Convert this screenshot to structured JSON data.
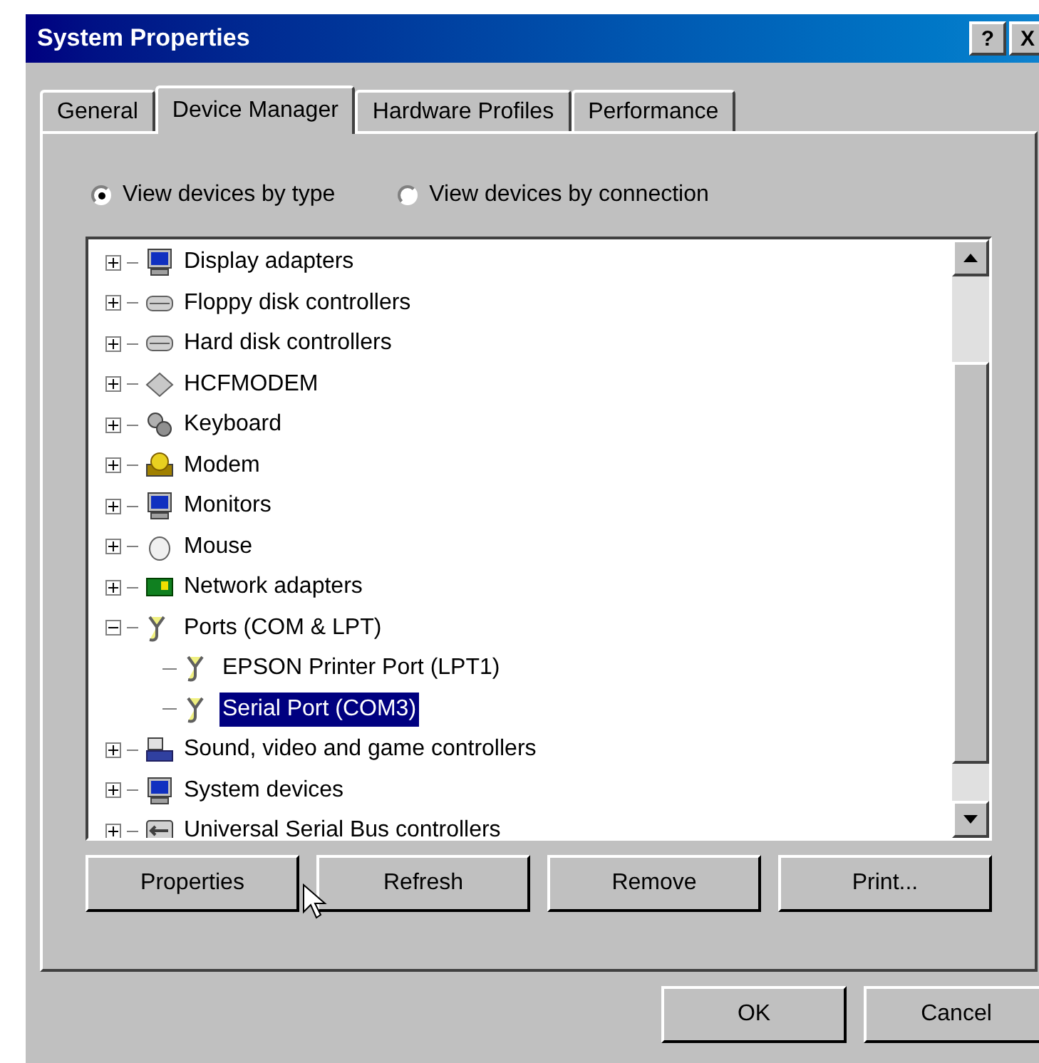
{
  "window": {
    "title": "System Properties",
    "controls": [
      "?",
      "X"
    ]
  },
  "tabs": [
    {
      "label": "General",
      "selected": false
    },
    {
      "label": "Device Manager",
      "selected": true
    },
    {
      "label": "Hardware Profiles",
      "selected": false
    },
    {
      "label": "Performance",
      "selected": false
    }
  ],
  "view_options": [
    {
      "label": "View devices by type",
      "selected": true
    },
    {
      "label": "View devices by connection",
      "selected": false
    }
  ],
  "device_tree": [
    {
      "label": "Display adapters",
      "expanded": false,
      "selected": false
    },
    {
      "label": "Floppy disk controllers",
      "expanded": false,
      "selected": false
    },
    {
      "label": "Hard disk controllers",
      "expanded": false,
      "selected": false
    },
    {
      "label": "HCFMODEM",
      "expanded": false,
      "selected": false
    },
    {
      "label": "Keyboard",
      "expanded": false,
      "selected": false
    },
    {
      "label": "Modem",
      "expanded": false,
      "selected": false
    },
    {
      "label": "Monitors",
      "expanded": false,
      "selected": false
    },
    {
      "label": "Mouse",
      "expanded": false,
      "selected": false
    },
    {
      "label": "Network adapters",
      "expanded": false,
      "selected": false
    },
    {
      "label": "Ports (COM & LPT)",
      "expanded": true,
      "selected": false,
      "children": [
        {
          "label": "EPSON Printer Port (LPT1)",
          "selected": false
        },
        {
          "label": "Serial Port (COM3)",
          "selected": true
        }
      ]
    },
    {
      "label": "Sound, video and game controllers",
      "expanded": false,
      "selected": false
    },
    {
      "label": "System devices",
      "expanded": false,
      "selected": false
    },
    {
      "label": "Universal Serial Bus controllers",
      "expanded": false,
      "selected": false
    }
  ],
  "device_buttons": [
    "Properties",
    "Refresh",
    "Remove",
    "Print..."
  ],
  "dialog_buttons": [
    "OK",
    "Cancel"
  ]
}
